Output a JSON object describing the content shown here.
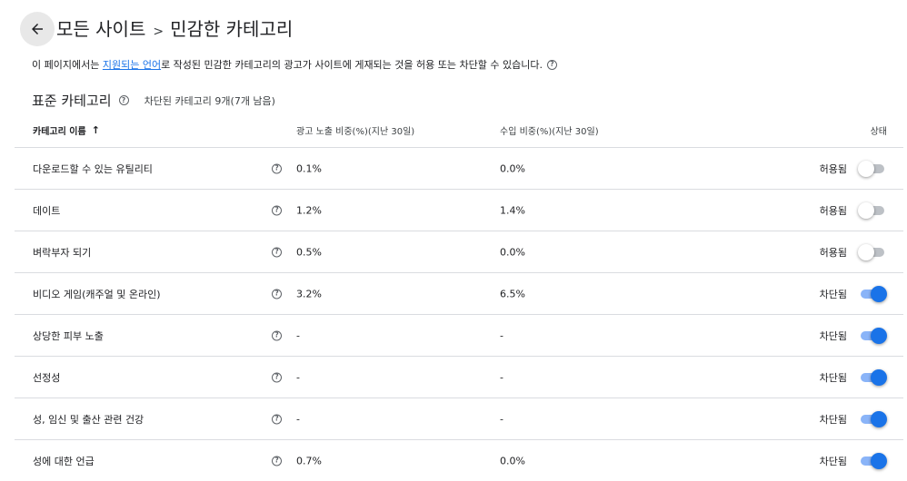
{
  "header": {
    "breadcrumb_root": "모든 사이트",
    "breadcrumb_sep": ">",
    "breadcrumb_current": "민감한 카테고리"
  },
  "description": {
    "prefix": "이 페이지에서는 ",
    "link": "지원되는 언어",
    "suffix": "로 작성된 민감한 카테고리의 광고가 사이트에 게재되는 것을 허용 또는 차단할 수 있습니다."
  },
  "section": {
    "title": "표준 카테고리",
    "blocked_summary": "차단된 카테고리 9개(7개 남음)"
  },
  "table": {
    "columns": {
      "name": "카테고리 이름",
      "impressions": "광고 노출 비중(%)(지난 30일)",
      "revenue": "수입 비중(%)(지난 30일)",
      "status": "상태"
    },
    "rows": [
      {
        "name": "다운로드할 수 있는 유틸리티",
        "impressions": "0.1%",
        "revenue": "0.0%",
        "status": "허용됨",
        "blocked": false
      },
      {
        "name": "데이트",
        "impressions": "1.2%",
        "revenue": "1.4%",
        "status": "허용됨",
        "blocked": false
      },
      {
        "name": "벼락부자 되기",
        "impressions": "0.5%",
        "revenue": "0.0%",
        "status": "허용됨",
        "blocked": false
      },
      {
        "name": "비디오 게임(캐주얼 및 온라인)",
        "impressions": "3.2%",
        "revenue": "6.5%",
        "status": "차단됨",
        "blocked": true
      },
      {
        "name": "상당한 피부 노출",
        "impressions": "-",
        "revenue": "-",
        "status": "차단됨",
        "blocked": true
      },
      {
        "name": "선정성",
        "impressions": "-",
        "revenue": "-",
        "status": "차단됨",
        "blocked": true
      },
      {
        "name": "성, 임신 및 출산 관련 건강",
        "impressions": "-",
        "revenue": "-",
        "status": "차단됨",
        "blocked": true
      },
      {
        "name": "성에 대한 언급",
        "impressions": "0.7%",
        "revenue": "0.0%",
        "status": "차단됨",
        "blocked": true
      }
    ]
  },
  "icons": {
    "back": "arrow-back-icon",
    "help": "help-circle-icon",
    "sort": "arrow-up-icon"
  },
  "colors": {
    "accent": "#1a73e8",
    "toggle_on_track": "#8ab4f8",
    "toggle_off_track": "#bdc1c6",
    "divider": "#dadce0"
  }
}
